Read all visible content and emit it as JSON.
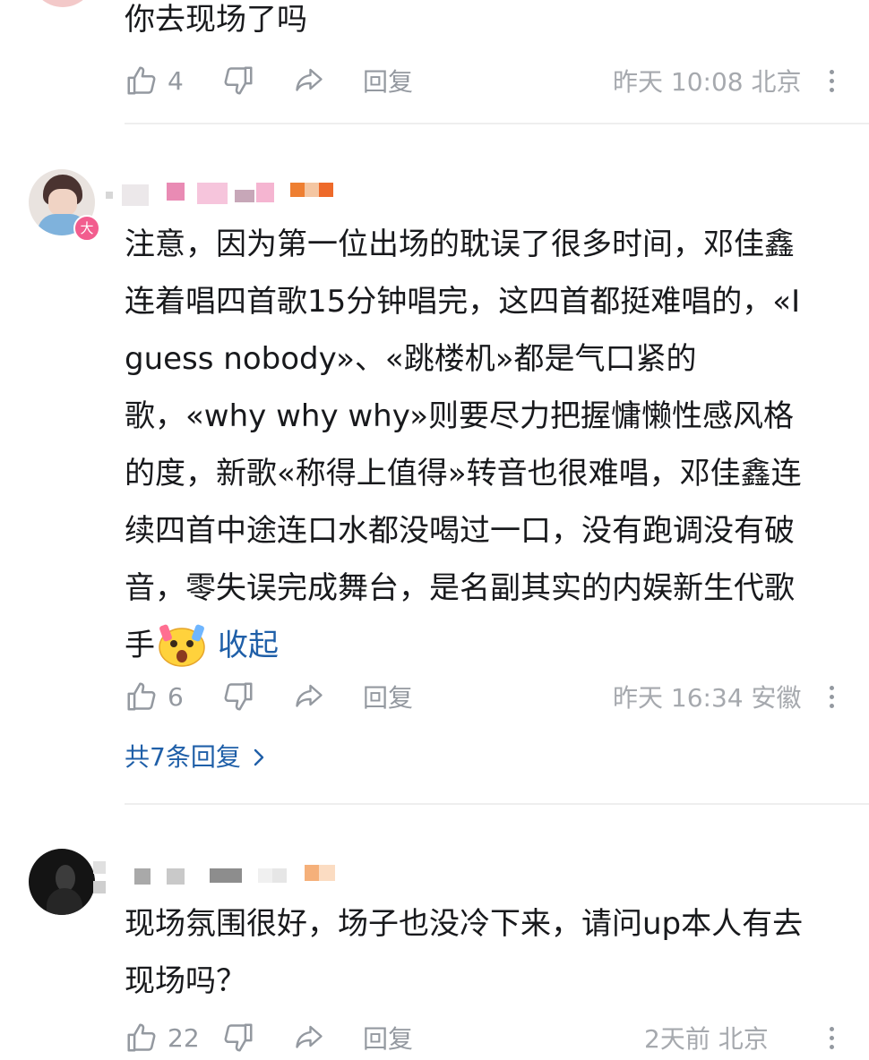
{
  "comments": [
    {
      "text_lines": [
        "你去现场了吗"
      ],
      "likes": "4",
      "reply_label": "回复",
      "time_location": "昨天 10:08 北京"
    },
    {
      "text_lines": [
        "注意，因为第一位出场的耽误了很多时间，邓佳鑫",
        "连着唱四首歌15分钟唱完，这四首都挺难唱的，«I",
        "guess nobody»、«跳楼机»都是气口紧的",
        "歌，«why why why»则要尽力把握慵懒性感风格",
        "的度，新歌«称得上值得»转音也很难唱，邓佳鑫连",
        "续四首中途连口水都没喝过一口，没有跑调没有破",
        "音，零失误完成舞台，是名副其实的内娱新生代歌",
        "手"
      ],
      "collapse_label": "收起",
      "avatar_badge": "大",
      "likes": "6",
      "reply_label": "回复",
      "time_location": "昨天 16:34 安徽",
      "replies_link": "共7条回复"
    },
    {
      "text_lines": [
        "现场氛围很好，场子也没冷下来，请问up本人有去",
        "现场吗？"
      ],
      "likes": "22",
      "reply_label": "回复",
      "time_location": "2天前 北京"
    }
  ],
  "colors": {
    "link": "#1f5fa8",
    "meta": "#a6a9ae",
    "icon": "#9499a0",
    "badge": "#f25d8e"
  }
}
